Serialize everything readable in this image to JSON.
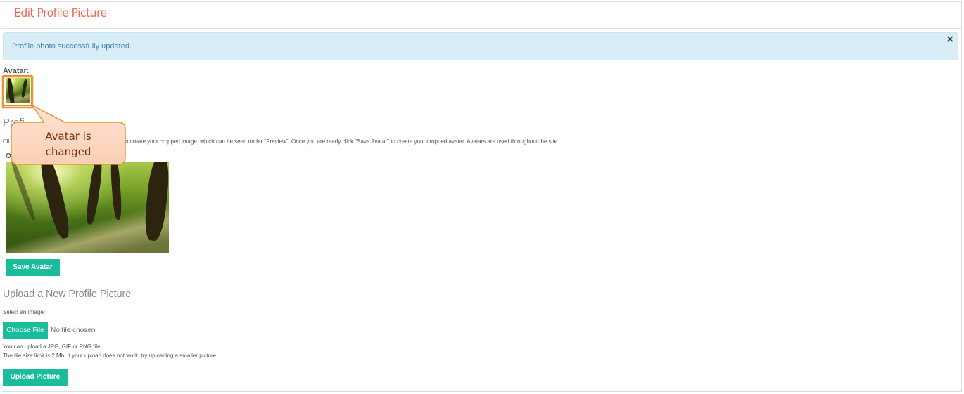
{
  "header": {
    "title": "Edit Profile Picture"
  },
  "alert": {
    "message": "Profile photo successfully updated.",
    "close_label": "×"
  },
  "avatar": {
    "label": "Avatar:"
  },
  "crop": {
    "title_visible": "Profi",
    "instruction_prefix": "Cli",
    "instruction_rest": "o create your cropped image, which can be seen under \"Preview\". Once you are ready click \"Save Avatar\" to create your cropped avatar. Avatars are used throughout the site.",
    "original_label_visible": "O",
    "save_button": "Save Avatar"
  },
  "upload": {
    "title": "Upload a New Profile Picture",
    "select_label": "Select an Image:",
    "choose_button": "Choose File",
    "no_file_text": "No file chosen",
    "help_line_1": "You can upload a JPG, GIF or PNG file.",
    "help_line_2": "The file size limit is 2 Mb. If your upload does not work, try uploading a smaller picture.",
    "upload_button": "Upload Picture"
  },
  "callout": {
    "text": "Avatar is changed"
  },
  "colors": {
    "accent": "#1abc9c",
    "title": "#f06a52",
    "alert_bg": "#d9edf7",
    "alert_text": "#3a87ad",
    "callout_border": "#f0922e"
  },
  "icons": {
    "close": "close-icon"
  }
}
